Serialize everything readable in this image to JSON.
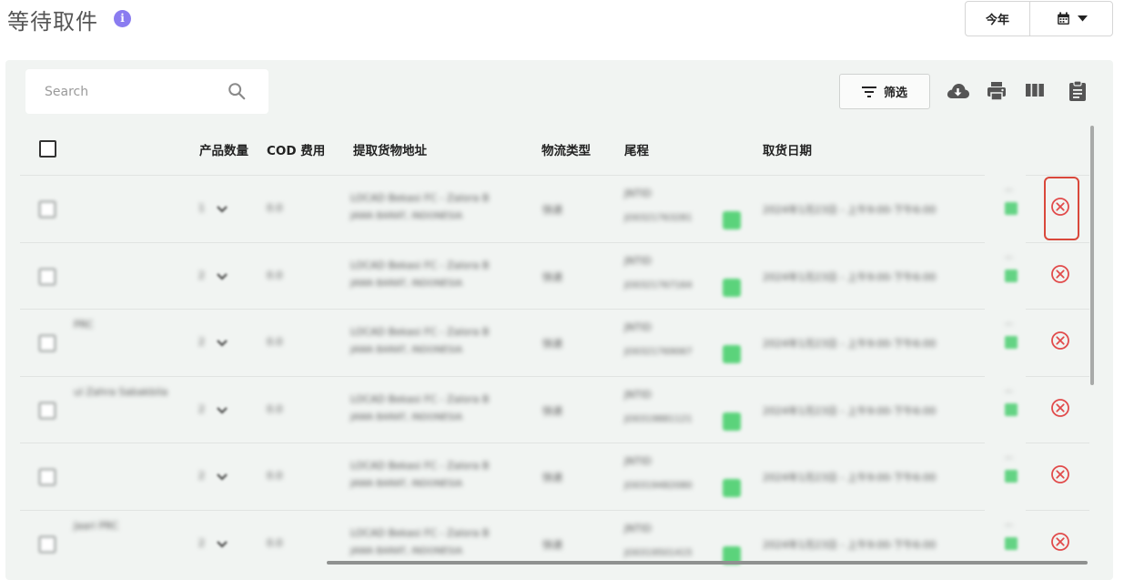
{
  "header": {
    "title": "等待取件",
    "info_icon": "info-icon",
    "period_label": "今年",
    "calendar_icon": "calendar-icon",
    "dropdown_icon": "caret-down-icon"
  },
  "toolbar": {
    "search_placeholder": "Search",
    "search_icon": "search-icon",
    "filter_label": "筛选",
    "filter_icon": "filter-icon",
    "download_icon": "cloud-download-icon",
    "print_icon": "print-icon",
    "columns_icon": "columns-icon",
    "clipboard_icon": "clipboard-icon"
  },
  "table": {
    "columns": [
      "产品数量",
      "COD 费用",
      "提取货物地址",
      "物流类型",
      "尾程",
      "取货日期"
    ],
    "rows": [
      {
        "name": "",
        "qty": "1",
        "cod": "0.0",
        "address_1": "LOCAD Bekasi FC - Zalora B",
        "address_2": "JAWA BARAT, INDONESIA",
        "logistics": "快递",
        "carrier": "JNTID",
        "tracking": "JO0321763281",
        "date": "2024年1月23日 - 上午9:00-下午6:00",
        "status": "---"
      },
      {
        "name": "",
        "qty": "2",
        "cod": "0.0",
        "address_1": "LOCAD Bekasi FC - Zalora B",
        "address_2": "JAWA BARAT, INDONESIA",
        "logistics": "快递",
        "carrier": "JNTID",
        "tracking": "JO0321767164",
        "date": "2024年1月23日 - 上午9:00-下午6:00",
        "status": "---"
      },
      {
        "name": "PRC",
        "qty": "2",
        "cod": "0.0",
        "address_1": "LOCAD Bekasi FC - Zalora B",
        "address_2": "JAWA BARAT, INDONESIA",
        "logistics": "快递",
        "carrier": "JNTID",
        "tracking": "JO0321769067",
        "date": "2024年1月23日 - 上午9:00-下午6:00",
        "status": "---"
      },
      {
        "name": "ul Zahra Sabakbila",
        "qty": "2",
        "cod": "0.0",
        "address_1": "LOCAD Bekasi FC - Zalora B",
        "address_2": "JAWA BARAT, INDONESIA",
        "logistics": "快递",
        "carrier": "JNTID",
        "tracking": "JO0319881121",
        "date": "2024年1月23日 - 上午9:00-下午6:00",
        "status": "---"
      },
      {
        "name": "",
        "qty": "2",
        "cod": "0.0",
        "address_1": "LOCAD Bekasi FC - Zalora B",
        "address_2": "JAWA BARAT, INDONESIA",
        "logistics": "快递",
        "carrier": "JNTID",
        "tracking": "JO0319482080",
        "date": "2024年1月23日 - 上午9:00-下午6:00",
        "status": "---"
      },
      {
        "name": "Jaari PRC",
        "qty": "2",
        "cod": "0.0",
        "address_1": "LOCAD Bekasi FC - Zalora B",
        "address_2": "JAWA BARAT, INDONESIA",
        "logistics": "快递",
        "carrier": "JNTID",
        "tracking": "JO0319501415",
        "date": "2024年1月23日 - 上午9:00-下午6:00",
        "status": "---"
      }
    ]
  },
  "colors": {
    "accent_info": "#8a7cf0",
    "cancel_red": "#e14b4b",
    "copy_green": "#5bd37b",
    "highlight_red": "#d9483b"
  }
}
